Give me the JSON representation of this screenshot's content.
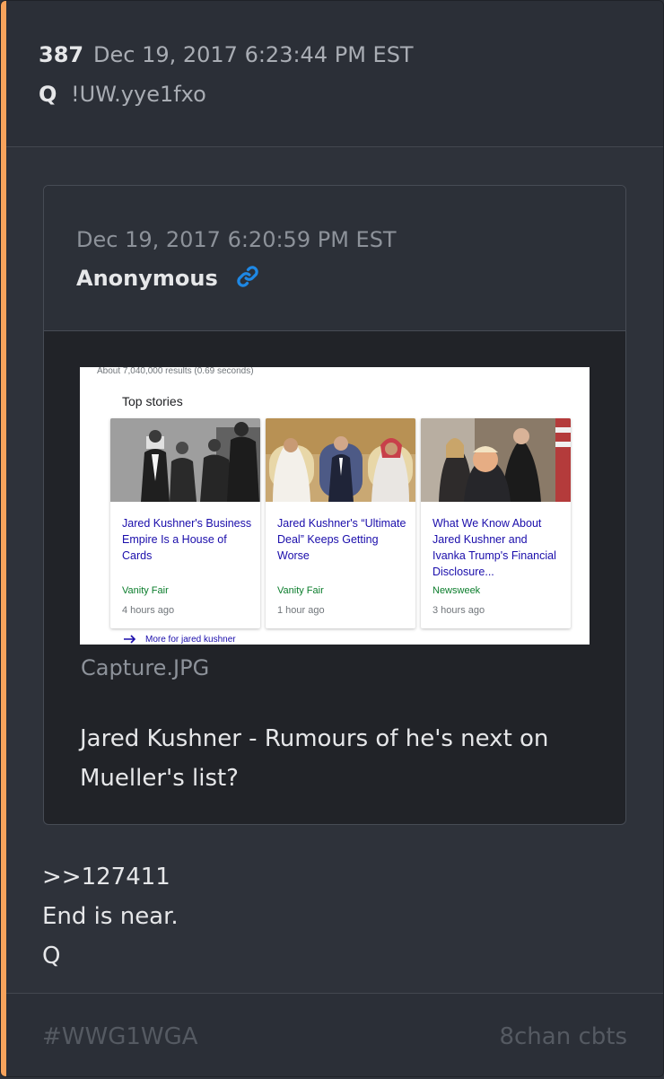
{
  "post": {
    "number": "387",
    "date": "Dec 19, 2017 6:23:44 PM EST",
    "author": "Q",
    "tripcode": "!UW.yye1fxo",
    "body_lines": [
      ">>127411",
      "End is near.",
      "Q"
    ]
  },
  "quoted": {
    "date": "Dec 19, 2017 6:20:59 PM EST",
    "author": "Anonymous",
    "link_icon": "link-icon",
    "filename": "Capture.JPG",
    "text": "Jared Kushner - Rumours of he's next on Mueller's list?",
    "image": {
      "results": "About 7,040,000 results (0.69 seconds)",
      "section": "Top stories",
      "more": "More for jared kushner",
      "stories": [
        {
          "title": "Jared Kushner's Business Empire Is a House of Cards",
          "source": "Vanity Fair",
          "age": "4 hours ago"
        },
        {
          "title": "Jared Kushner's “Ultimate Deal” Keeps Getting Worse",
          "source": "Vanity Fair",
          "age": "1 hour ago"
        },
        {
          "title": "What We Know About Jared Kushner and Ivanka Trump's Financial Disclosure...",
          "source": "Newsweek",
          "age": "3 hours ago"
        }
      ]
    }
  },
  "footer": {
    "hashtag": "#WWG1WGA",
    "board": "8chan cbts"
  },
  "colors": {
    "accent": "#f7a35c",
    "link": "#1e88e5"
  }
}
